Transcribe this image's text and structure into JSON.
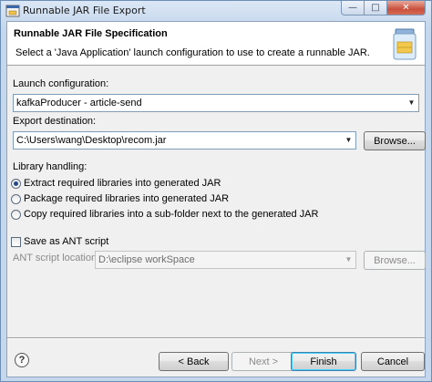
{
  "window": {
    "title": "Runnable JAR File Export",
    "minimize_glyph": "—",
    "maximize_glyph": "□",
    "close_glyph": "✕"
  },
  "banner": {
    "title": "Runnable JAR File Specification",
    "description": "Select a 'Java Application' launch configuration to use to create a runnable JAR."
  },
  "launch": {
    "label": "Launch configuration:",
    "value": "kafkaProducer - article-send"
  },
  "export": {
    "label": "Export destination:",
    "value": "C:\\Users\\wang\\Desktop\\recom.jar",
    "browse_label": "Browse..."
  },
  "library": {
    "label": "Library handling:",
    "options": [
      {
        "label": "Extract required libraries into generated JAR",
        "checked": true
      },
      {
        "label": "Package required libraries into generated JAR",
        "checked": false
      },
      {
        "label": "Copy required libraries into a sub-folder next to the generated JAR",
        "checked": false
      }
    ]
  },
  "ant": {
    "checkbox_label": "Save as ANT script",
    "location_label": "ANT script location:",
    "location_value": "D:\\eclipse workSpace",
    "browse_label": "Browse..."
  },
  "footer": {
    "help_glyph": "?",
    "back_label": "< Back",
    "next_label": "Next >",
    "finish_label": "Finish",
    "cancel_label": "Cancel"
  },
  "colors": {
    "accent_radio": "#23488b",
    "titlebar": "#c5d7ec",
    "close_button": "#c9503c"
  }
}
